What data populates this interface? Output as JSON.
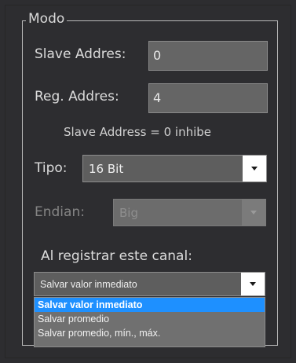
{
  "group": {
    "title": "Modo"
  },
  "slave_address": {
    "label": "Slave Addres:",
    "value": "0"
  },
  "reg_address": {
    "label": "Reg. Addres:",
    "value": "4"
  },
  "note": "Slave Address = 0 inhibe",
  "tipo": {
    "label": "Tipo:",
    "selected": "16 Bit"
  },
  "endian": {
    "label": "Endian:",
    "selected": "Big",
    "enabled": false
  },
  "registro": {
    "label": "Al registrar este canal:",
    "selected": "Salvar valor inmediato",
    "options": [
      "Salvar valor inmediato",
      "Salvar promedio",
      "Salvar promedio, mín., máx."
    ],
    "highlighted_index": 0
  },
  "colors": {
    "background": "#2d2d30",
    "highlight": "#1e90ff",
    "textbox": "#656565"
  },
  "icons": {
    "dropdown_arrow": "chevron-down-icon"
  }
}
